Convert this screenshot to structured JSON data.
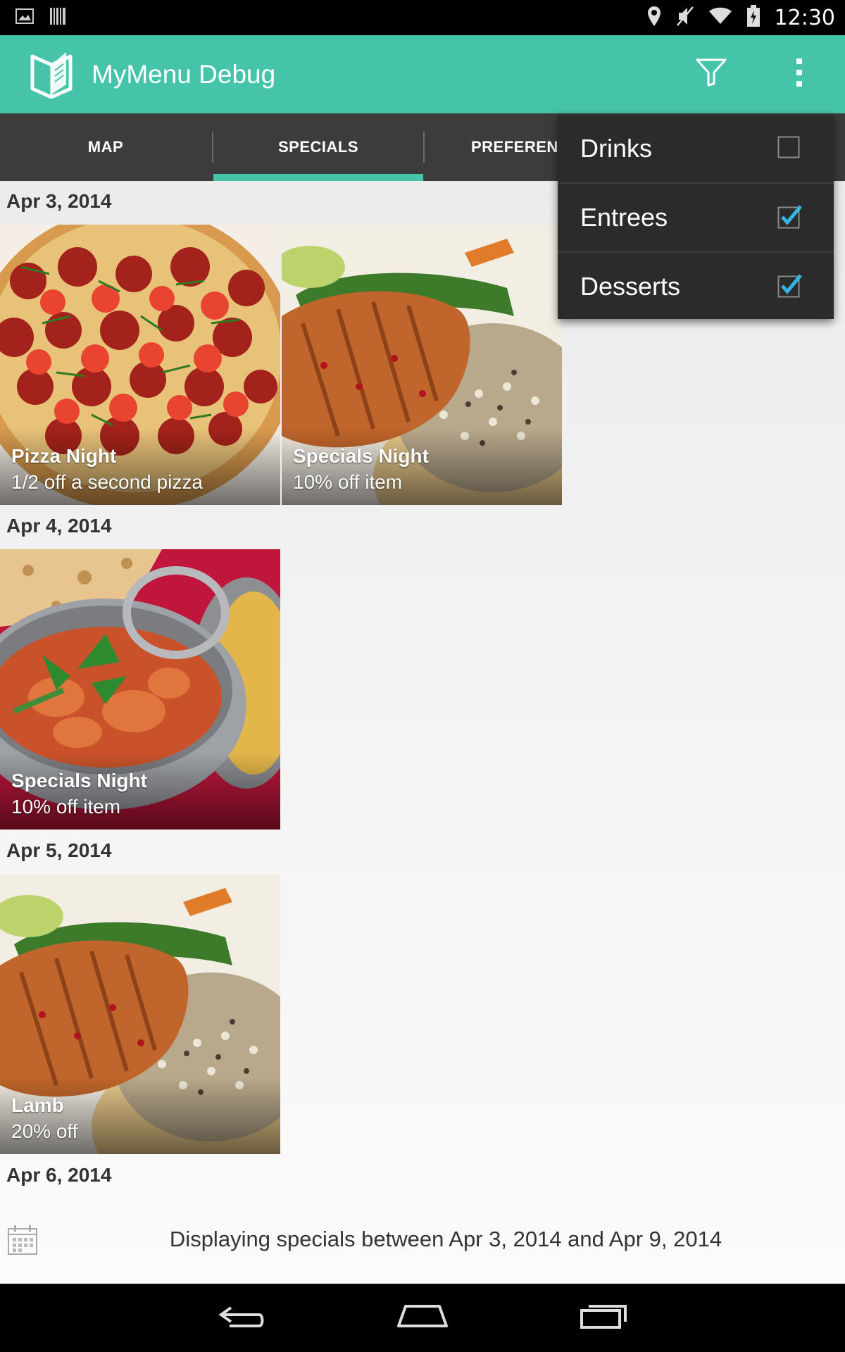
{
  "status_bar": {
    "time": "12:30",
    "icons": [
      "image-icon",
      "barcode-icon",
      "location-icon",
      "mute-icon",
      "wifi-icon",
      "battery-icon"
    ]
  },
  "action_bar": {
    "title": "MyMenu Debug",
    "background": "#45c4a9",
    "icons": [
      "app-logo-icon",
      "filter-icon",
      "overflow-menu-icon"
    ]
  },
  "tabs": [
    {
      "label": "MAP",
      "selected": false
    },
    {
      "label": "SPECIALS",
      "selected": true
    },
    {
      "label": "PREFERENCES",
      "selected": false
    }
  ],
  "sections": [
    {
      "date": "Apr 3, 2014",
      "items": [
        {
          "title": "Pizza Night",
          "subtitle": "1/2 off a second pizza",
          "image": "pizza"
        },
        {
          "title": "Specials Night",
          "subtitle": "10% off item",
          "image": "grilled-fish-rice"
        }
      ]
    },
    {
      "date": "Apr 4, 2014",
      "items": [
        {
          "title": "Specials Night",
          "subtitle": "10% off item",
          "image": "curry-bowl"
        }
      ]
    },
    {
      "date": "Apr 5, 2014",
      "items": [
        {
          "title": "Lamb",
          "subtitle": "20% off",
          "image": "grilled-fish-rice"
        }
      ]
    },
    {
      "date": "Apr 6, 2014",
      "items": []
    }
  ],
  "footer": {
    "text": "Displaying specials between Apr 3, 2014 and Apr 9, 2014",
    "icon": "calendar-icon"
  },
  "filter_menu": {
    "items": [
      {
        "label": "Drinks",
        "checked": false
      },
      {
        "label": "Entrees",
        "checked": true
      },
      {
        "label": "Desserts",
        "checked": true
      }
    ],
    "check_color": "#33b5e5"
  },
  "nav_bar": {
    "icons": [
      "back-icon",
      "home-icon",
      "recent-apps-icon"
    ]
  }
}
